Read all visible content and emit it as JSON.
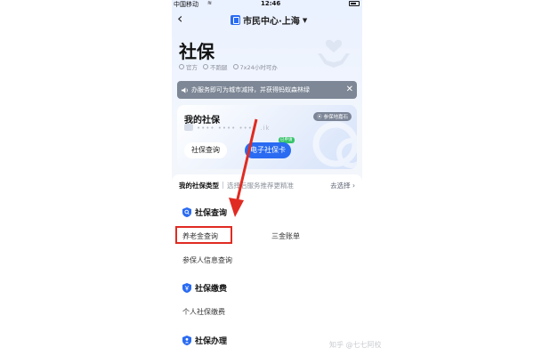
{
  "status_bar": {
    "carrier": "中国移动",
    "wifi": "WiFi",
    "time": "12:46"
  },
  "nav": {
    "title": "市民中心·上海"
  },
  "header": {
    "title": "社保",
    "tags": [
      "官方",
      "不跑腿",
      "7x24小时可办"
    ]
  },
  "notice": {
    "text": "办服务即可为城市减排，并获得蚂蚁森林绿"
  },
  "card": {
    "title": "我的社保",
    "location_badge": "参保地嘉石",
    "masked_id": "•••• •••• •••• .ik",
    "query_button": "社保查询",
    "card_button": "电子社保卡",
    "card_button_badge": "已申请"
  },
  "type_row": {
    "label": "我的社保类型",
    "hint": "选择后服务推荐更精准",
    "action": "去选择 ›"
  },
  "sections": [
    {
      "title": "社保查询",
      "items": [
        "养老金查询",
        "三金账单",
        "参保人信息查询"
      ]
    },
    {
      "title": "社保缴费",
      "items": [
        "个人社保缴费"
      ]
    },
    {
      "title": "社保办理",
      "items": []
    }
  ],
  "watermark": "知乎 @七七阿校",
  "colors": {
    "accent": "#2a6bf2",
    "highlight": "#e02b22",
    "notice_bg": "#7d8796"
  }
}
